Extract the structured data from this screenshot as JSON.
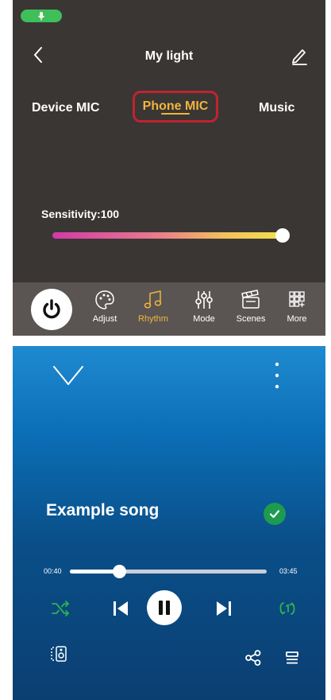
{
  "header": {
    "title": "My light"
  },
  "modes": {
    "device": "Device MIC",
    "phone": "Phone MIC",
    "music": "Music",
    "selected": "Phone MIC"
  },
  "sensitivity": {
    "label": "Sensitivity:100",
    "value": 100,
    "max": 100
  },
  "toolbar": {
    "items": [
      {
        "label": "Adjust",
        "icon": "palette-icon"
      },
      {
        "label": "Rhythm",
        "icon": "music-note-icon"
      },
      {
        "label": "Mode",
        "icon": "sliders-icon"
      },
      {
        "label": "Scenes",
        "icon": "clapperboard-icon"
      },
      {
        "label": "More",
        "icon": "grid-plus-icon"
      }
    ],
    "active": "Rhythm"
  },
  "player": {
    "song": "Example song",
    "elapsed": "00:40",
    "duration": "03:45",
    "progress": 0.25
  },
  "colors": {
    "accent": "#f0b53c",
    "green": "#3fbf5a",
    "topbg": "#3a3634",
    "blue": "#0b6eb6"
  }
}
